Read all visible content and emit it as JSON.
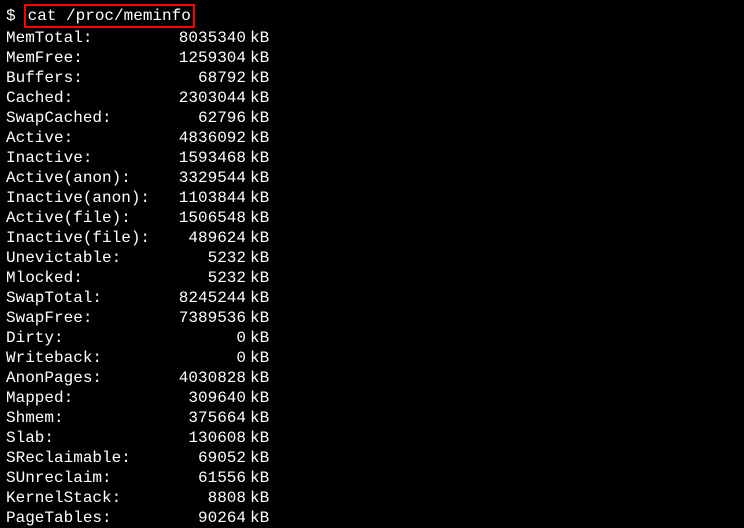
{
  "prompt": "$",
  "command": "cat /proc/meminfo",
  "unit": "kB",
  "rows": [
    {
      "label": "MemTotal:",
      "value": "8035340"
    },
    {
      "label": "MemFree:",
      "value": "1259304"
    },
    {
      "label": "Buffers:",
      "value": "68792"
    },
    {
      "label": "Cached:",
      "value": "2303044"
    },
    {
      "label": "SwapCached:",
      "value": "62796"
    },
    {
      "label": "Active:",
      "value": "4836092"
    },
    {
      "label": "Inactive:",
      "value": "1593468"
    },
    {
      "label": "Active(anon):",
      "value": "3329544"
    },
    {
      "label": "Inactive(anon):",
      "value": "1103844"
    },
    {
      "label": "Active(file):",
      "value": "1506548"
    },
    {
      "label": "Inactive(file):",
      "value": "489624"
    },
    {
      "label": "Unevictable:",
      "value": "5232"
    },
    {
      "label": "Mlocked:",
      "value": "5232"
    },
    {
      "label": "SwapTotal:",
      "value": "8245244"
    },
    {
      "label": "SwapFree:",
      "value": "7389536"
    },
    {
      "label": "Dirty:",
      "value": "0"
    },
    {
      "label": "Writeback:",
      "value": "0"
    },
    {
      "label": "AnonPages:",
      "value": "4030828"
    },
    {
      "label": "Mapped:",
      "value": "309640"
    },
    {
      "label": "Shmem:",
      "value": "375664"
    },
    {
      "label": "Slab:",
      "value": "130608"
    },
    {
      "label": "SReclaimable:",
      "value": "69052"
    },
    {
      "label": "SUnreclaim:",
      "value": "61556"
    },
    {
      "label": "KernelStack:",
      "value": "8808"
    },
    {
      "label": "PageTables:",
      "value": "90264"
    }
  ]
}
